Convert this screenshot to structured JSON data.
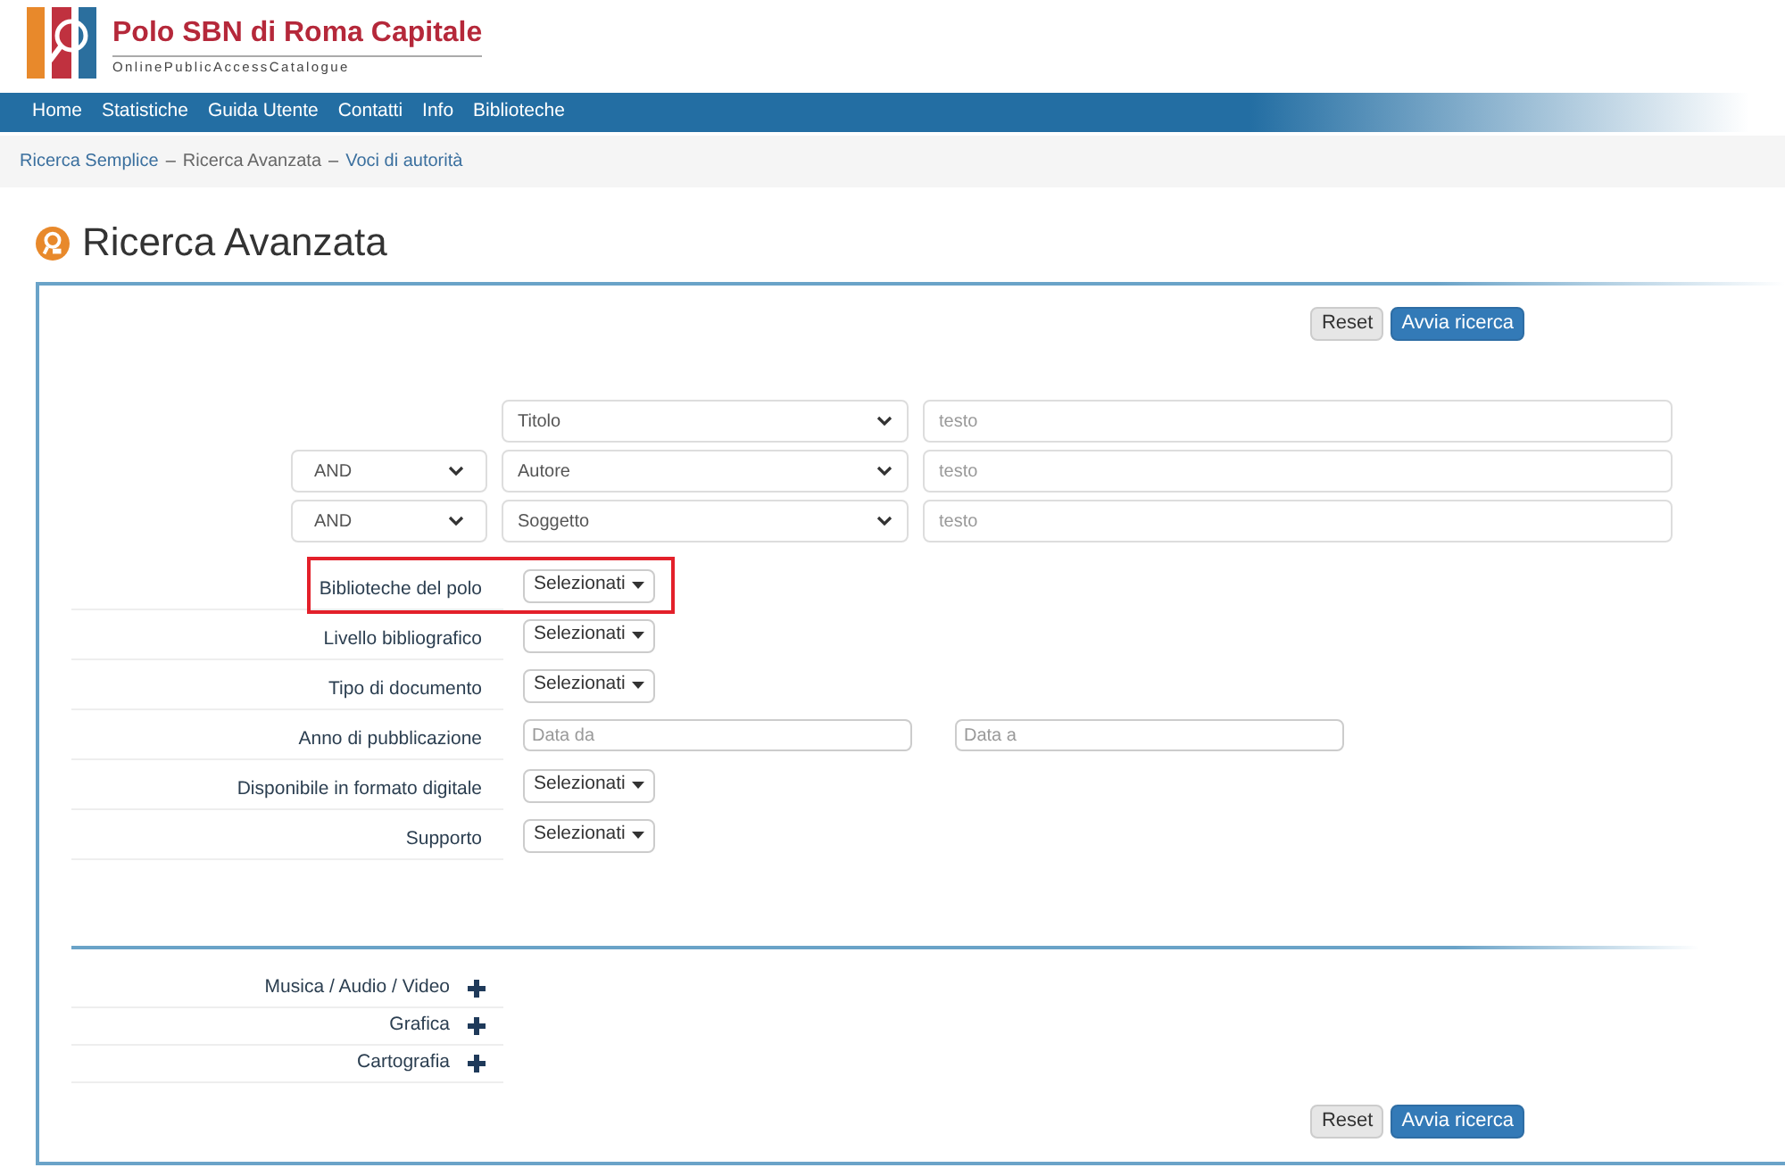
{
  "logo": {
    "title": "Polo SBN di Roma Capitale",
    "subtitle": "OnlinePublicAccessCatalogue"
  },
  "nav": [
    "Home",
    "Statistiche",
    "Guida Utente",
    "Contatti",
    "Info",
    "Biblioteche"
  ],
  "breadcrumb": [
    "Ricerca Semplice",
    "Ricerca Avanzata",
    "Voci di autorità"
  ],
  "breadcrumb_separator": "–",
  "page_title": "Ricerca Avanzata",
  "top_buttons": {
    "reset": "Reset",
    "search": "Avvia ricerca"
  },
  "query_rows": [
    {
      "operator": null,
      "field": "Titolo",
      "placeholder": "testo"
    },
    {
      "operator": "AND",
      "field": "Autore",
      "placeholder": "testo"
    },
    {
      "operator": "AND",
      "field": "Soggetto",
      "placeholder": "testo"
    }
  ],
  "filters": [
    {
      "label": "Biblioteche del polo",
      "kind": "dropdown",
      "value": "Selezionati",
      "highlighted": true
    },
    {
      "label": "Livello bibliografico",
      "kind": "dropdown",
      "value": "Selezionati",
      "highlighted": false
    },
    {
      "label": "Tipo di documento",
      "kind": "dropdown",
      "value": "Selezionati",
      "highlighted": false
    },
    {
      "label": "Anno di pubblicazione",
      "kind": "range",
      "from_placeholder": "Data da",
      "to_placeholder": "Data a",
      "highlighted": false
    },
    {
      "label": "Disponibile in formato digitale",
      "kind": "dropdown",
      "value": "Selezionati",
      "highlighted": false
    },
    {
      "label": "Supporto",
      "kind": "dropdown",
      "value": "Selezionati",
      "highlighted": false
    }
  ],
  "sections": [
    {
      "label": "Musica / Audio / Video",
      "expanded": false
    },
    {
      "label": "Grafica",
      "expanded": false
    },
    {
      "label": "Cartografia",
      "expanded": false
    }
  ],
  "bottom_buttons": {
    "reset": "Reset",
    "search": "Avvia ricerca"
  }
}
